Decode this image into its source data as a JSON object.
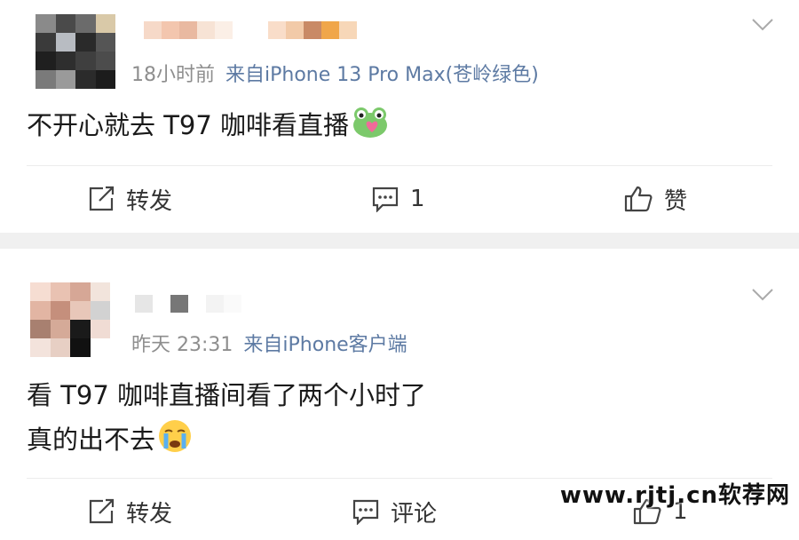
{
  "posts": [
    {
      "time": "18小时前",
      "source": "来自iPhone 13 Pro Max(苍岭绿色)",
      "content_lines": [
        "不开心就去 T97 咖啡看直播"
      ],
      "emoji": "frog-heart-emoji",
      "actions": {
        "repost": "转发",
        "comment": "1",
        "like": "赞"
      }
    },
    {
      "time": "昨天 23:31",
      "source": "来自iPhone客户端",
      "content_lines": [
        "看 T97 咖啡直播间看了两个小时了",
        "真的出不去"
      ],
      "emoji": "crying-face-emoji",
      "actions": {
        "repost": "转发",
        "comment": "评论",
        "like": "1"
      }
    }
  ],
  "watermark": "www.rjtj.cn软荐网",
  "colors": {
    "source_link": "#5d7aa3",
    "meta_gray": "#8e8e8e",
    "separator": "#f0f0f0"
  },
  "icons": [
    "chevron-down-icon",
    "repost-icon",
    "comment-icon",
    "like-icon"
  ]
}
